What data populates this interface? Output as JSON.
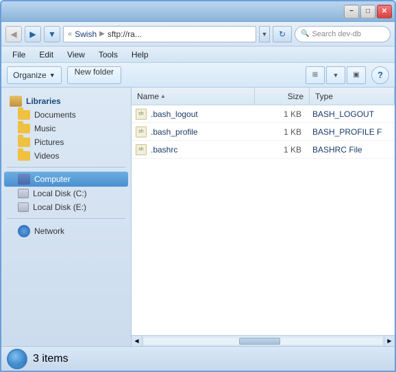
{
  "window": {
    "title": "sftp://ra...",
    "minimize_label": "−",
    "maximize_label": "□",
    "close_label": "✕"
  },
  "address_bar": {
    "back_icon": "◀",
    "forward_icon": "▶",
    "dropdown_icon": "▼",
    "refresh_icon": "↻",
    "path_prefix": "«",
    "path_part1": "Swish",
    "path_arrow": "▶",
    "path_part2": "sftp://ra...",
    "search_placeholder": "Search dev-db",
    "search_icon": "🔍"
  },
  "menu": {
    "items": [
      "File",
      "Edit",
      "View",
      "Tools",
      "Help"
    ]
  },
  "toolbar": {
    "organize_label": "Organize",
    "organize_arrow": "▼",
    "new_folder_label": "New folder",
    "view_icon": "≡",
    "view_arrow": "▼",
    "pane_icon": "▣",
    "help_label": "?"
  },
  "sidebar": {
    "sections": [
      {
        "id": "libraries",
        "title": "Libraries",
        "icon": "lib",
        "items": [
          {
            "id": "documents",
            "label": "Documents",
            "icon": "folder"
          },
          {
            "id": "music",
            "label": "Music",
            "icon": "folder"
          },
          {
            "id": "pictures",
            "label": "Pictures",
            "icon": "folder"
          },
          {
            "id": "videos",
            "label": "Videos",
            "icon": "folder"
          }
        ]
      },
      {
        "id": "computer",
        "title": "Computer",
        "icon": "computer",
        "selected": true,
        "items": [
          {
            "id": "local-c",
            "label": "Local Disk (C:)",
            "icon": "drive"
          },
          {
            "id": "local-e",
            "label": "Local Disk (E:)",
            "icon": "drive"
          }
        ]
      },
      {
        "id": "network",
        "title": "Network",
        "icon": "network",
        "items": []
      }
    ]
  },
  "files": {
    "columns": [
      {
        "id": "name",
        "label": "Name",
        "sort": "asc"
      },
      {
        "id": "size",
        "label": "Size"
      },
      {
        "id": "type",
        "label": "Type"
      }
    ],
    "rows": [
      {
        "id": 1,
        "name": ".bash_logout",
        "size": "1 KB",
        "type": "BASH_LOGOUT"
      },
      {
        "id": 2,
        "name": ".bash_profile",
        "size": "1 KB",
        "type": "BASH_PROFILE F"
      },
      {
        "id": 3,
        "name": ".bashrc",
        "size": "1 KB",
        "type": "BASHRC File"
      }
    ]
  },
  "status_bar": {
    "item_count": "3 items"
  }
}
